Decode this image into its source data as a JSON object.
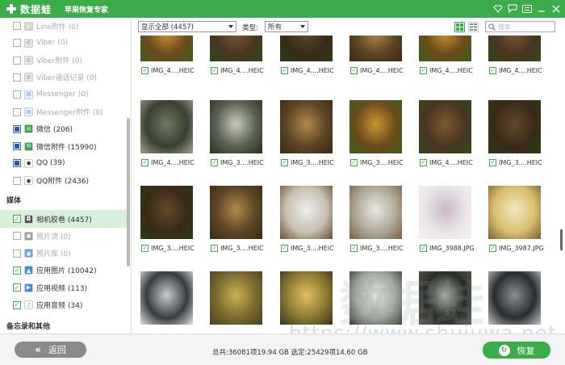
{
  "titlebar": {
    "logo_text": "数据蛙",
    "subtitle": "苹果恢复专家",
    "icons": [
      "diamond-icon",
      "chat-icon",
      "menu-icon",
      "minimize-icon",
      "close-icon"
    ]
  },
  "sidebar": {
    "items": [
      {
        "label": "Line附件 (0)",
        "state": "unchecked",
        "dim": true,
        "icon": "line-icon"
      },
      {
        "label": "Viber (0)",
        "state": "unchecked",
        "dim": true,
        "icon": "viber-icon"
      },
      {
        "label": "Viber附件 (0)",
        "state": "unchecked",
        "dim": true,
        "icon": "viber-icon"
      },
      {
        "label": "Viber通话记录 (0)",
        "state": "unchecked",
        "dim": true,
        "icon": "viber-icon"
      },
      {
        "label": "Messenger (0)",
        "state": "unchecked",
        "dim": true,
        "icon": "messenger-icon"
      },
      {
        "label": "Messenger附件 (0)",
        "state": "unchecked",
        "dim": true,
        "icon": "messenger-icon"
      },
      {
        "label": "微信 (206)",
        "state": "partial",
        "dim": false,
        "icon": "wechat-icon"
      },
      {
        "label": "微信附件 (15990)",
        "state": "partial",
        "dim": false,
        "icon": "wechat-icon"
      },
      {
        "label": "QQ (39)",
        "state": "partial",
        "dim": false,
        "icon": "qq-icon"
      },
      {
        "label": "QQ附件 (2436)",
        "state": "unchecked",
        "dim": false,
        "icon": "qq-icon"
      }
    ],
    "media_heading": "媒体",
    "media_items": [
      {
        "label": "相机胶卷 (4457)",
        "state": "checked",
        "dim": false,
        "active": true,
        "icon": "camera-icon"
      },
      {
        "label": "照片流 (0)",
        "state": "unchecked",
        "dim": true,
        "icon": "photostream-icon"
      },
      {
        "label": "照片库 (0)",
        "state": "unchecked",
        "dim": true,
        "icon": "photolib-icon"
      },
      {
        "label": "应用图片 (10042)",
        "state": "checked",
        "dim": false,
        "icon": "app-image-icon"
      },
      {
        "label": "应用视频 (113)",
        "state": "checked",
        "dim": false,
        "icon": "app-video-icon"
      },
      {
        "label": "应用音频 (34)",
        "state": "checked",
        "dim": false,
        "icon": "music-note-icon"
      }
    ],
    "memo_heading": "备忘录和其他"
  },
  "toolbar": {
    "filter_value": "显示全部 (4457)",
    "type_label": "类型:",
    "type_value": "所有",
    "search_placeholder": "搜索"
  },
  "grid": {
    "rows": [
      [
        "IMG_4....HEIC",
        "IMG_4....HEIC",
        "IMG_4....HEIC",
        "IMG_4....HEIC",
        "IMG_4....HEIC",
        "IMG_4....HEIC"
      ],
      [
        "IMG_4....HEIC",
        "IMG_3....HEIC",
        "IMG_3....HEIC",
        "IMG_3....HEIC",
        "IMG_4....HEIC",
        "IMG_3....HEIC"
      ],
      [
        "IMG_3....HEIC",
        "IMG_3....HEIC",
        "IMG_3....HEIC",
        "IMG_3....HEIC",
        "IMG_3988.JPG",
        "IMG_3987.JPG"
      ],
      [
        "",
        "",
        "",
        "",
        "",
        ""
      ]
    ]
  },
  "watermark": "https://www.shujuwa.net",
  "watermark_big": "数据蛙",
  "footer": {
    "back_label": "返回",
    "summary": "总共:36081项19.94 GB 选定:25429项14.60 GB",
    "recover_label": "恢复"
  },
  "colors": {
    "accent": "#3cab4a",
    "active_bg": "#d6f0da",
    "back_button": "#8a8a8a"
  }
}
